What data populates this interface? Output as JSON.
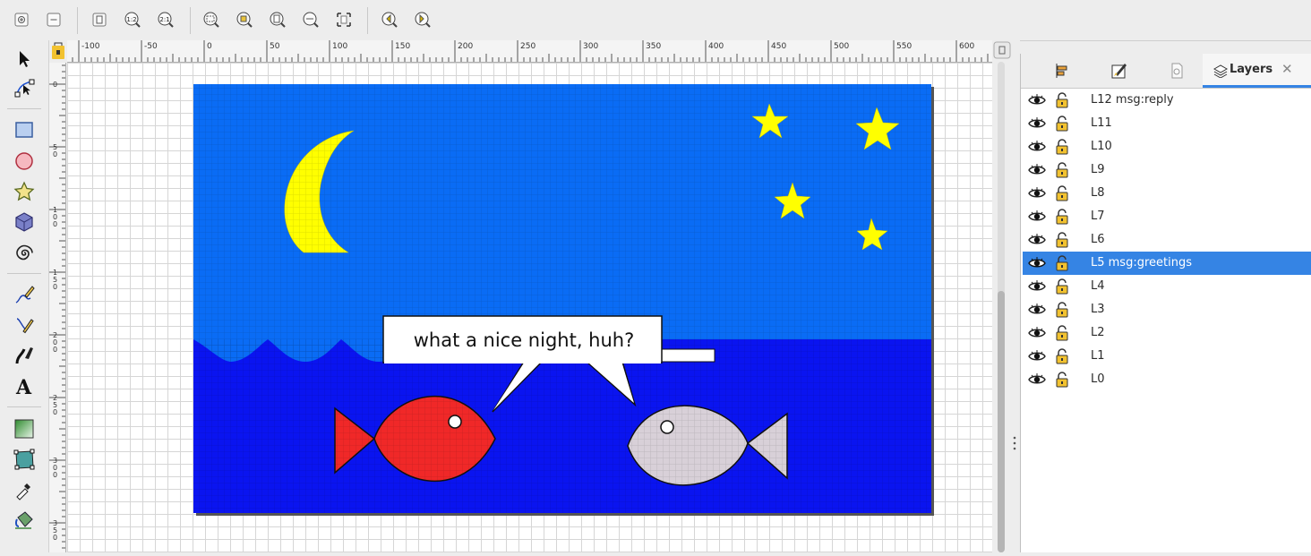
{
  "toolbar": {
    "icons": [
      "zoom-in-icon",
      "zoom-out-icon",
      "zoom-page-icon",
      "zoom-1-1-icon",
      "zoom-2-1-icon",
      "zoom-selection-icon",
      "zoom-drawing-icon",
      "zoom-page-fit-icon",
      "zoom-width-icon",
      "fit-canvas-icon",
      "zoom-previous-icon",
      "zoom-next-icon"
    ],
    "zoom_1_1": "1:2",
    "zoom_2_1": "2:1"
  },
  "tools": [
    "selector-tool",
    "node-tool",
    "rectangle-tool",
    "ellipse-tool",
    "star-tool",
    "3d-box-tool",
    "spiral-tool",
    "pencil-tool",
    "pen-tool",
    "calligraphy-tool",
    "text-tool",
    "gradient-tool",
    "mesh-tool",
    "dropper-tool",
    "paint-bucket-tool"
  ],
  "text_tool_glyph": "A",
  "ruler": {
    "h_ticks": [
      "-100",
      "-50",
      "0",
      "50",
      "100",
      "150",
      "200",
      "250",
      "300",
      "350",
      "400",
      "450",
      "500",
      "550",
      "600"
    ],
    "v_ticks": [
      "0",
      "50",
      "100",
      "150",
      "200",
      "250",
      "300",
      "350"
    ]
  },
  "artwork": {
    "speech_text": "what a nice night, huh?",
    "colors": {
      "sky": "#0a6cf5",
      "sea": "#0a14f0",
      "moon": "#ffff00",
      "red_fish": "#f02828",
      "gray_fish": "#d8d0d8"
    }
  },
  "panel": {
    "tabs": [
      "align-icon",
      "fill-stroke-icon",
      "document-properties-icon"
    ],
    "active_tab": "Layers",
    "layers": [
      {
        "name": "L12 msg:reply",
        "selected": false
      },
      {
        "name": "L11",
        "selected": false
      },
      {
        "name": "L10",
        "selected": false
      },
      {
        "name": "L9",
        "selected": false
      },
      {
        "name": "L8",
        "selected": false
      },
      {
        "name": "L7",
        "selected": false
      },
      {
        "name": "L6",
        "selected": false
      },
      {
        "name": "L5 msg:greetings",
        "selected": true
      },
      {
        "name": "L4",
        "selected": false
      },
      {
        "name": "L3",
        "selected": false
      },
      {
        "name": "L2",
        "selected": false
      },
      {
        "name": "L1",
        "selected": false
      },
      {
        "name": "L0",
        "selected": false
      }
    ]
  }
}
